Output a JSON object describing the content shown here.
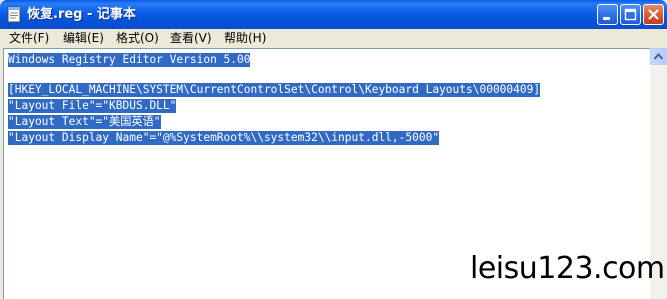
{
  "window": {
    "title": "恢复.reg - 记事本"
  },
  "menubar": {
    "items": [
      {
        "label": "文件(F)"
      },
      {
        "label": "编辑(E)"
      },
      {
        "label": "格式(O)"
      },
      {
        "label": "查看(V)"
      },
      {
        "label": "帮助(H)"
      }
    ]
  },
  "editor": {
    "lines": [
      "Windows Registry Editor Version 5.00",
      "",
      "[HKEY_LOCAL_MACHINE\\SYSTEM\\CurrentControlSet\\Control\\Keyboard Layouts\\00000409]",
      "\"Layout File\"=\"KBDUS.DLL\"",
      "\"Layout Text\"=\"美国英语\"",
      "\"Layout Display Name\"=\"@%SystemRoot%\\\\system32\\\\input.dll,-5000\""
    ],
    "selection_color": "#316ac5"
  },
  "watermark": {
    "text": "leisu123.com"
  },
  "icons": {
    "app": "notepad-icon",
    "minimize": "minimize-icon",
    "maximize": "maximize-icon",
    "close": "close-icon",
    "scroll_up": "arrow-up-icon"
  },
  "colors": {
    "titlebar": "#0a58e8",
    "close_button": "#d9582e"
  }
}
